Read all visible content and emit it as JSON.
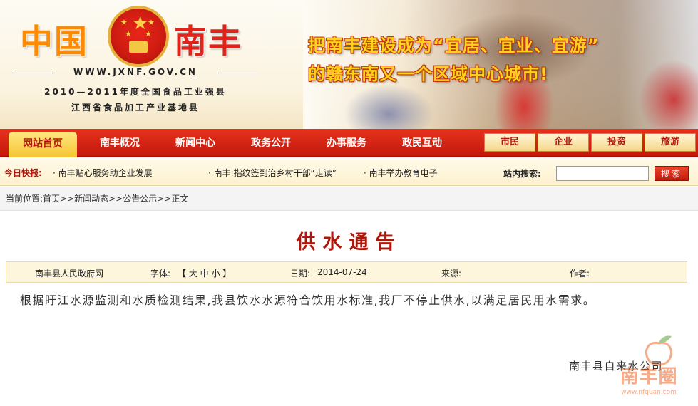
{
  "banner": {
    "logo_left": "中国",
    "logo_right": "南丰",
    "url": "WWW.JXNF.GOV.CN",
    "honor_1": "2010—2011年度全国食品工业强县",
    "honor_2": "江西省食品加工产业基地县",
    "slogan_1": "把南丰建设成为“宜居、宜业、宜游”",
    "slogan_2": "的赣东南又一个区域中心城市!"
  },
  "nav": {
    "items": [
      "网站首页",
      "南丰概况",
      "新闻中心",
      "政务公开",
      "办事服务",
      "政民互动"
    ],
    "categories": [
      "市民",
      "企业",
      "投资",
      "旅游"
    ]
  },
  "ticker": {
    "label": "今日快报:",
    "items": [
      "· 南丰贴心服务助企业发展",
      "· 南丰:指纹签到治乡村干部“走读”",
      "· 南丰举办教育电子"
    ]
  },
  "search": {
    "label": "站内搜索:",
    "placeholder": "",
    "button": "搜索"
  },
  "breadcrumb": {
    "prefix": "当前位置:",
    "items": [
      "首页",
      "新闻动态",
      "公告公示",
      "正文"
    ],
    "separator": ">>"
  },
  "article": {
    "title": "供水通告",
    "meta": {
      "source_site": "南丰县人民政府网",
      "font_label": "字体:",
      "font_sizes": "【 大  中  小 】",
      "date_label": "日期:",
      "date": "2014-07-24",
      "origin_label": "来源:",
      "author_label": "作者:"
    },
    "body": "根据盱江水源监测和水质检测结果,我县饮水水源符合饮用水标准,我厂不停止供水,以满足居民用水需求。",
    "signature": "南丰县自来水公司"
  },
  "watermark": {
    "text": "南丰圈",
    "url": "www.nfquan.com"
  },
  "colors": {
    "nav_red": "#c4180c",
    "accent_gold": "#f5c532",
    "title_red": "#b0170b",
    "slogan_yellow": "#ffd21c",
    "logo_orange": "#ff8a00"
  }
}
